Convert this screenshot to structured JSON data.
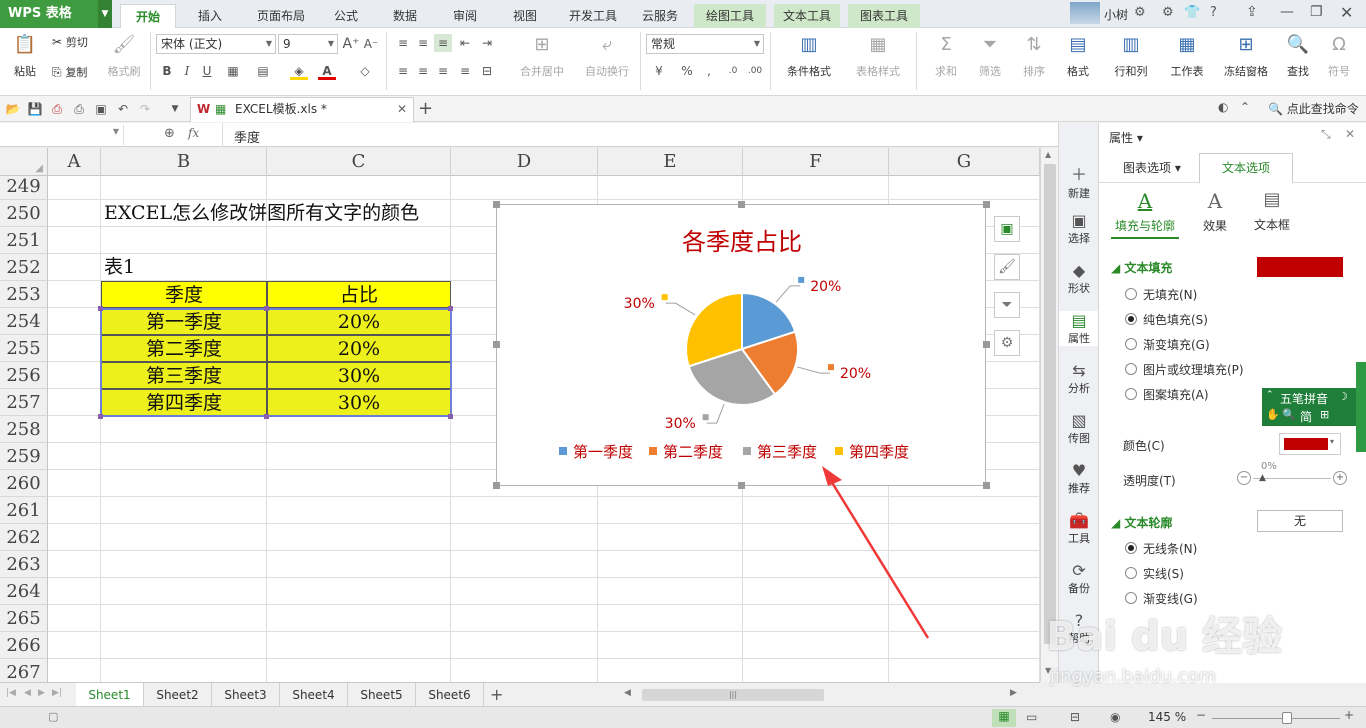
{
  "app": {
    "name": "WPS 表格",
    "menu_tabs": [
      "开始",
      "插入",
      "页面布局",
      "公式",
      "数据",
      "审阅",
      "视图",
      "开发工具",
      "云服务",
      "绘图工具",
      "文本工具",
      "图表工具"
    ],
    "active_tab": "开始",
    "user": "小树"
  },
  "ribbon": {
    "paste": "粘贴",
    "cut": "剪切",
    "copy": "复制",
    "format_painter": "格式刷",
    "font_name": "宋体 (正文)",
    "font_size": "9",
    "merge": "合并居中",
    "wrap": "自动换行",
    "number_format": "常规",
    "cond_format": "条件格式",
    "table_style": "表格样式",
    "sum": "求和",
    "filter": "筛选",
    "sort": "排序",
    "format": "格式",
    "rows_cols": "行和列",
    "worksheet": "工作表",
    "freeze": "冻结窗格",
    "find": "查找",
    "symbol": "符号"
  },
  "quickbar": {
    "doc_title": "EXCEL模板.xls *",
    "search": "点此查找命令"
  },
  "formula_bar": {
    "fx": "fx",
    "content": "季度"
  },
  "columns": [
    "A",
    "B",
    "C",
    "D",
    "E",
    "F",
    "G"
  ],
  "rows": [
    "249",
    "250",
    "251",
    "252",
    "253",
    "254",
    "255",
    "256",
    "257",
    "258",
    "259",
    "260",
    "261",
    "262",
    "263",
    "264",
    "265",
    "266",
    "267"
  ],
  "sheet": {
    "title": "EXCEL怎么修改饼图所有文字的颜色",
    "table_label": "表1",
    "header": [
      "季度",
      "占比"
    ],
    "data": [
      [
        "第一季度",
        "20%"
      ],
      [
        "第二季度",
        "20%"
      ],
      [
        "第三季度",
        "30%"
      ],
      [
        "第四季度",
        "30%"
      ]
    ]
  },
  "chart_data": {
    "type": "pie",
    "title": "各季度占比",
    "categories": [
      "第一季度",
      "第二季度",
      "第三季度",
      "第四季度"
    ],
    "values": [
      20,
      20,
      30,
      30
    ],
    "data_labels": [
      "20%",
      "20%",
      "30%",
      "30%"
    ],
    "colors": [
      "#5b9bd5",
      "#ed7d31",
      "#a5a5a5",
      "#ffc000"
    ],
    "text_color": "#c00000",
    "legend": "bottom"
  },
  "rail": [
    "新建",
    "选择",
    "形状",
    "属性",
    "分析",
    "传图",
    "推荐",
    "工具",
    "备份",
    "帮助"
  ],
  "panel": {
    "title": "属性",
    "tabs": [
      "图表选项",
      "文本选项"
    ],
    "active_tab": "文本选项",
    "subtabs": [
      "填充与轮廓",
      "效果",
      "文本框"
    ],
    "text_fill": {
      "title": "文本填充",
      "options": [
        "无填充(N)",
        "纯色填充(S)",
        "渐变填充(G)",
        "图片或纹理填充(P)",
        "图案填充(A)"
      ],
      "selected": 1,
      "color_label": "颜色(C)",
      "transparency_label": "透明度(T)",
      "transparency_value": "0%",
      "fill_color": "#c00000"
    },
    "text_outline": {
      "title": "文本轮廓",
      "options": [
        "无线条(N)",
        "实线(S)",
        "渐变线(G)"
      ],
      "selected": 0,
      "value": "无"
    }
  },
  "sheets": [
    "Sheet1",
    "Sheet2",
    "Sheet3",
    "Sheet4",
    "Sheet5",
    "Sheet6"
  ],
  "active_sheet": "Sheet1",
  "status": {
    "zoom": "145 %"
  },
  "ime": {
    "name": "五笔拼音",
    "mode": "简"
  },
  "watermark": {
    "brand": "Bai du 经验",
    "url": "jingyan.baidu.com"
  }
}
